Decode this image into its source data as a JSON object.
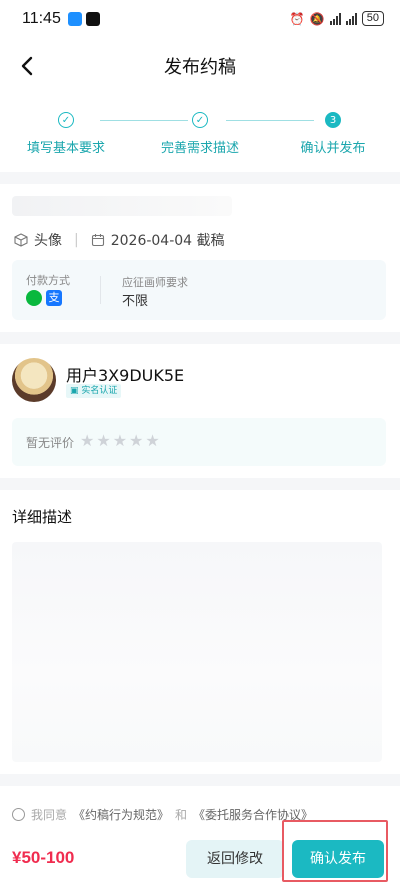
{
  "status_bar": {
    "time": "11:45",
    "battery": "50"
  },
  "header": {
    "title": "发布约稿"
  },
  "steps": [
    {
      "label": "填写基本要求",
      "icon": "check",
      "state": "done"
    },
    {
      "label": "完善需求描述",
      "icon": "check",
      "state": "done"
    },
    {
      "label": "确认并发布",
      "number": "3",
      "state": "active"
    }
  ],
  "summary": {
    "category": "头像",
    "deadline": "2026-04-04 截稿",
    "payment_label": "付款方式",
    "requirement_label": "应征画师要求",
    "requirement_value": "不限",
    "payment_icons": [
      "wechat-pay-icon",
      "alipay-icon"
    ]
  },
  "user": {
    "name": "用户3X9DUK5E",
    "badge": "实名认证",
    "rating_label": "暂无评价",
    "rating": 0,
    "rating_max": 5
  },
  "description": {
    "title": "详细描述"
  },
  "bottom": {
    "agree_prefix": "我同意",
    "doc1": "《约稿行为规范》",
    "and": "和",
    "doc2": "《委托服务合作协议》",
    "price": "¥50-100",
    "edit_button": "返回修改",
    "publish_button": "确认发布"
  },
  "colors": {
    "accent": "#1bb9c2",
    "price": "#f02c4f",
    "highlight": "#e85a62"
  }
}
